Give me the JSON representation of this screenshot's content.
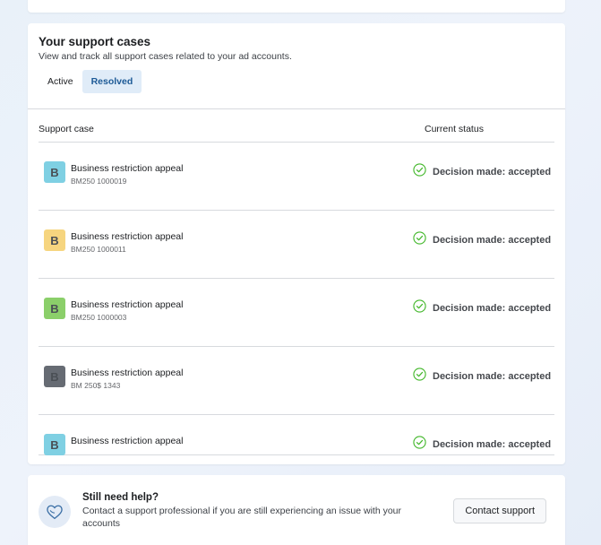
{
  "cases_card": {
    "title": "Your support cases",
    "subtitle": "View and track all support cases related to your ad accounts.",
    "tabs": [
      {
        "label": "Active",
        "selected": false
      },
      {
        "label": "Resolved",
        "selected": true
      }
    ],
    "columns": {
      "case": "Support case",
      "status": "Current status"
    },
    "rows": [
      {
        "badge": "B",
        "badge_color": "#7fd0e3",
        "title": "Business restriction appeal",
        "case_id": "BM250 1000019",
        "status": "Decision made: accepted"
      },
      {
        "badge": "B",
        "badge_color": "#f6d57f",
        "title": "Business restriction appeal",
        "case_id": "BM250 1000011",
        "status": "Decision made: accepted"
      },
      {
        "badge": "B",
        "badge_color": "#8bcf6a",
        "title": "Business restriction appeal",
        "case_id": "BM250 1000003",
        "status": "Decision made: accepted"
      },
      {
        "badge": "B",
        "badge_color": "#666b73",
        "title": "Business restriction appeal",
        "case_id": "BM 250$ 1343",
        "status": "Decision made: accepted"
      },
      {
        "badge": "B",
        "badge_color": "#7fd0e3",
        "title": "Business restriction appeal",
        "case_id": "",
        "status": "Decision made: accepted"
      }
    ],
    "status_icon": "check-circle-icon",
    "status_color": "#42b72a"
  },
  "help_card": {
    "icon": "heart-icon",
    "title": "Still need help?",
    "description": "Contact a support professional if you are still experiencing an issue with your accounts",
    "button_label": "Contact support"
  }
}
